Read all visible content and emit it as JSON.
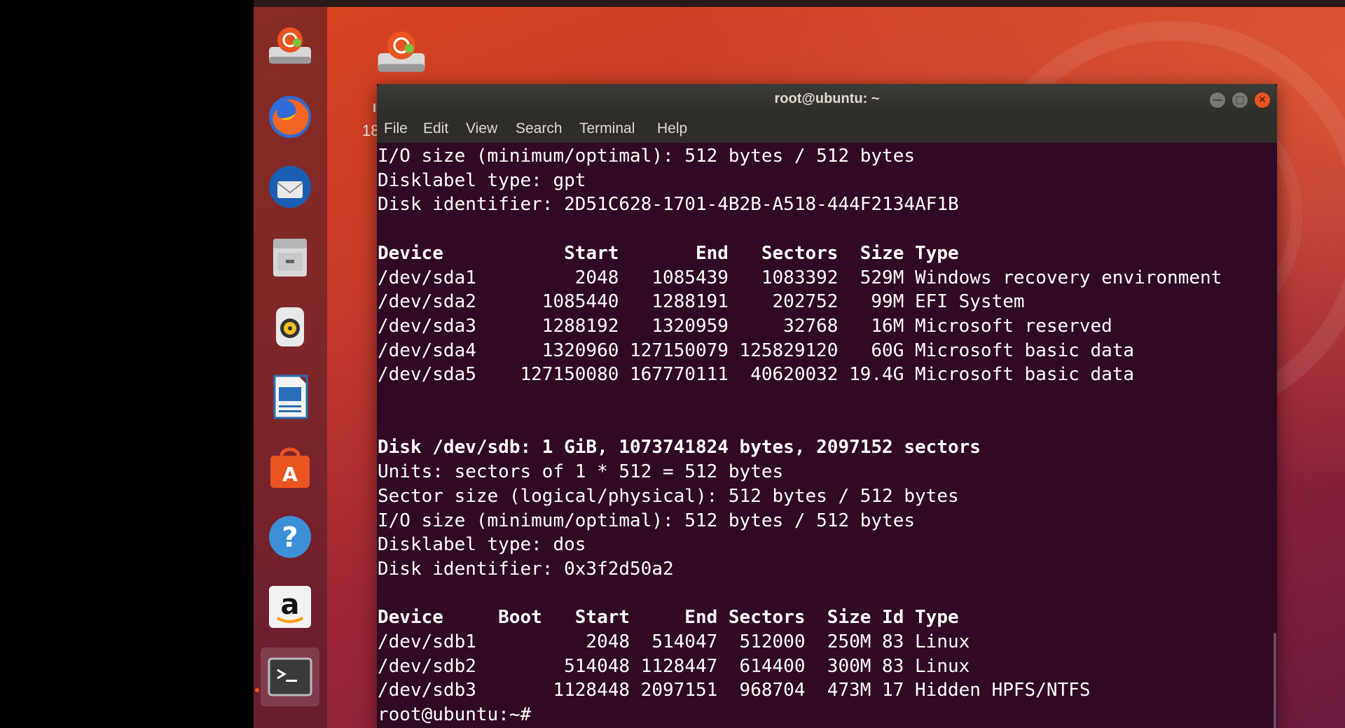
{
  "window": {
    "title": "root@ubuntu: ~",
    "menu": [
      "File",
      "Edit",
      "View",
      "Search",
      "Terminal",
      "Help"
    ],
    "min_glyph": "—",
    "max_glyph": "□",
    "close_glyph": "✕"
  },
  "desktop": {
    "stray_label": "18"
  },
  "launcher": {
    "items": [
      "ubuntu-installer-icon",
      "firefox-icon",
      "thunderbird-icon",
      "files-icon",
      "rhythmbox-icon",
      "libreoffice-writer-icon",
      "software-center-icon",
      "help-icon",
      "amazon-icon",
      "terminal-icon"
    ]
  },
  "terminal": {
    "lines": [
      "I/O size (minimum/optimal): 512 bytes / 512 bytes",
      "Disklabel type: gpt",
      "Disk identifier: 2D51C628-1701-4B2B-A518-444F2134AF1B",
      "",
      "Device           Start       End   Sectors  Size Type",
      "/dev/sda1         2048   1085439   1083392  529M Windows recovery environment",
      "/dev/sda2      1085440   1288191    202752   99M EFI System",
      "/dev/sda3      1288192   1320959     32768   16M Microsoft reserved",
      "/dev/sda4      1320960 127150079 125829120   60G Microsoft basic data",
      "/dev/sda5    127150080 167770111  40620032 19.4G Microsoft basic data",
      "",
      "",
      "Disk /dev/sdb: 1 GiB, 1073741824 bytes, 2097152 sectors",
      "Units: sectors of 1 * 512 = 512 bytes",
      "Sector size (logical/physical): 512 bytes / 512 bytes",
      "I/O size (minimum/optimal): 512 bytes / 512 bytes",
      "Disklabel type: dos",
      "Disk identifier: 0x3f2d50a2",
      "",
      "Device     Boot   Start     End Sectors  Size Id Type",
      "/dev/sdb1          2048  514047  512000  250M 83 Linux",
      "/dev/sdb2        514048 1128447  614400  300M 83 Linux",
      "/dev/sdb3       1128448 2097151  968704  473M 17 Hidden HPFS/NTFS",
      "root@ubuntu:~#"
    ],
    "bold_lines": [
      4,
      12,
      19
    ]
  }
}
